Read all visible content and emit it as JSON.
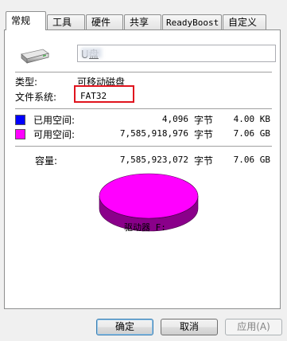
{
  "tabs": [
    {
      "label": "常规",
      "active": true
    },
    {
      "label": "工具"
    },
    {
      "label": "硬件"
    },
    {
      "label": "共享"
    },
    {
      "label": "ReadyBoost"
    },
    {
      "label": "自定义"
    }
  ],
  "drive": {
    "icon": "removable-drive-icon",
    "name": "U盘"
  },
  "info": {
    "type_label": "类型:",
    "type_value": "可移动磁盘",
    "fs_label": "文件系统:",
    "fs_value": "FAT32"
  },
  "space": {
    "used": {
      "label": "已用空间:",
      "bytes": "4,096",
      "unit": "字节",
      "size": "4.00 KB",
      "color": "#0000ff"
    },
    "free": {
      "label": "可用空间:",
      "bytes": "7,585,918,976",
      "unit": "字节",
      "size": "7.06 GB",
      "color": "#ff00ff"
    },
    "capacity": {
      "label": "容量:",
      "bytes": "7,585,923,072",
      "unit": "字节",
      "size": "7.06 GB"
    }
  },
  "chart_data": {
    "type": "pie",
    "categories": [
      "已用空间",
      "可用空间"
    ],
    "values": [
      4096,
      7585918976
    ],
    "colors": [
      "#0000ff",
      "#ff00ff"
    ]
  },
  "drive_label": "驱动器 F:",
  "buttons": {
    "ok": "确定",
    "cancel": "取消",
    "apply": "应用(A)"
  }
}
